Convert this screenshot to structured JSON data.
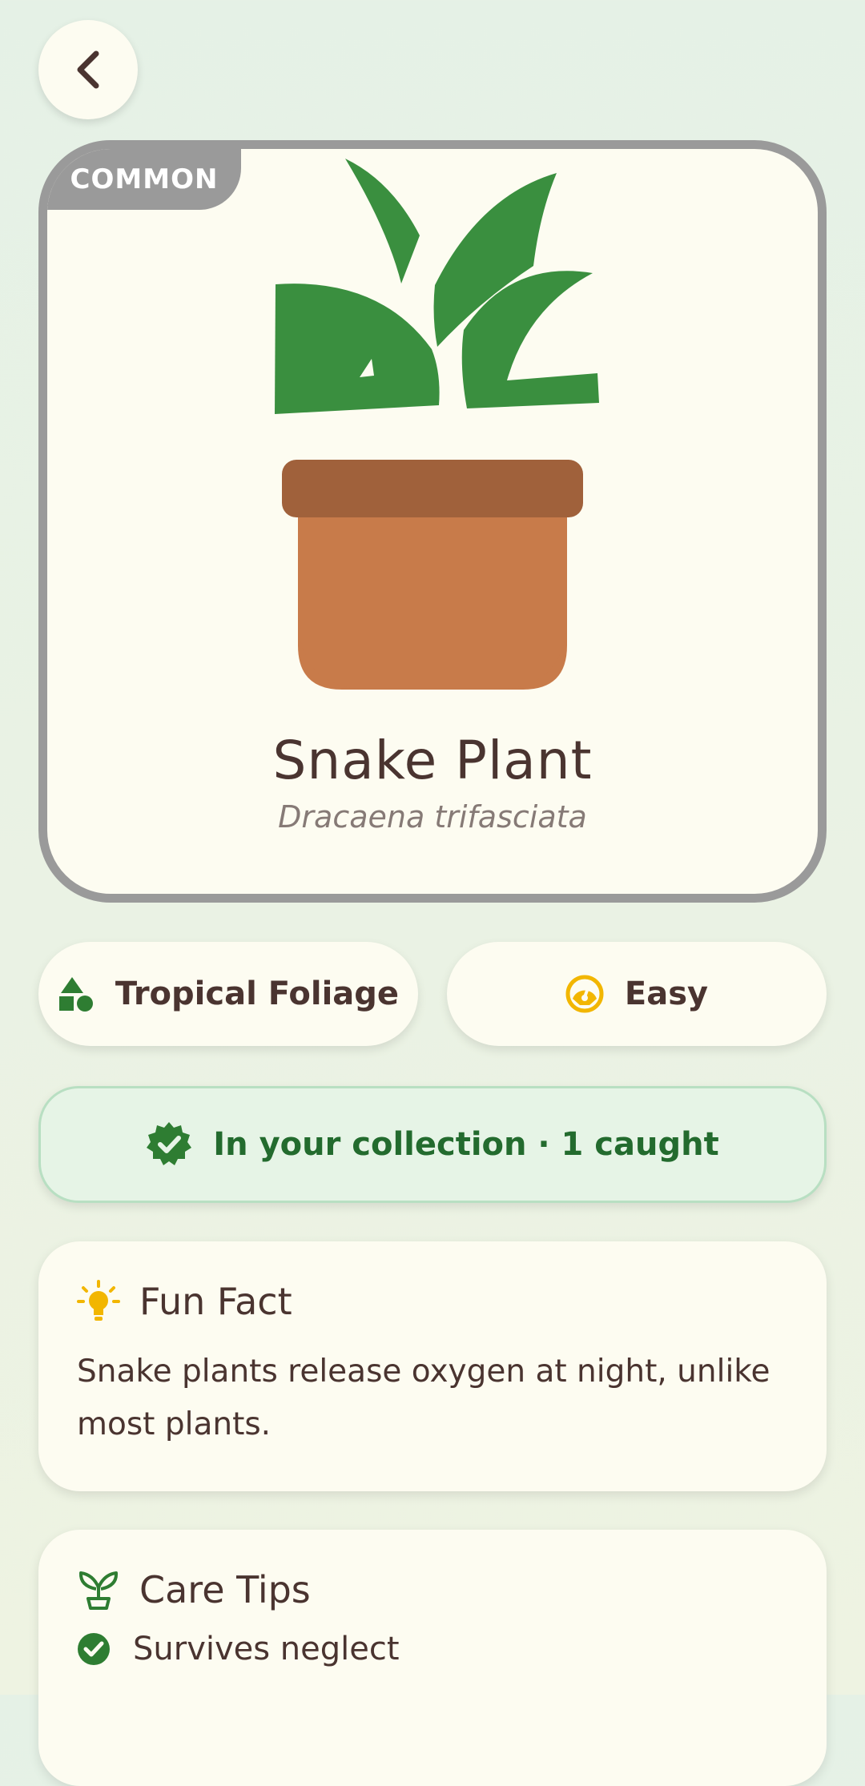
{
  "colors": {
    "background_top": "#e5f1e6",
    "card": "#fdfcf1",
    "rarity_border": "#9a9a9a",
    "leaf_green": "#3a8f3f",
    "pot_rim": "#a0613b",
    "pot_body": "#c87b4a",
    "collection_bg": "#e6f4e6",
    "collection_text": "#236b2e",
    "accent_yellow": "#f2b600",
    "text": "#4a3430"
  },
  "header": {
    "back_icon": "chevron-left-icon"
  },
  "plant": {
    "rarity": "COMMON",
    "name": "Snake Plant",
    "scientific_name": "Dracaena trifasciata"
  },
  "chips": {
    "category": {
      "icon": "shapes-icon",
      "label": "Tropical Foliage"
    },
    "difficulty": {
      "icon": "speedometer-icon",
      "label": "Easy"
    }
  },
  "collection": {
    "icon": "verified-badge-icon",
    "text": "In your collection · 1 caught"
  },
  "fun_fact": {
    "icon": "lightbulb-icon",
    "title": "Fun Fact",
    "text": "Snake plants release oxygen at night, unlike most plants."
  },
  "care_tips": {
    "icon": "sprout-icon",
    "title": "Care Tips",
    "items": [
      {
        "icon": "check-circle-icon",
        "text": "Survives neglect"
      }
    ]
  }
}
